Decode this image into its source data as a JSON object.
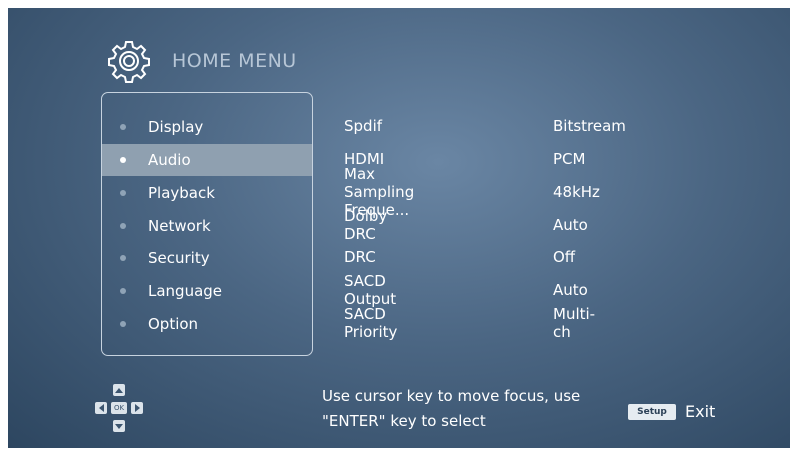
{
  "header": {
    "title": "HOME MENU",
    "icon": "gear-icon"
  },
  "menu": {
    "items": [
      {
        "label": "Display",
        "selected": false
      },
      {
        "label": "Audio",
        "selected": true
      },
      {
        "label": "Playback",
        "selected": false
      },
      {
        "label": "Network",
        "selected": false
      },
      {
        "label": "Security",
        "selected": false
      },
      {
        "label": "Language",
        "selected": false
      },
      {
        "label": "Option",
        "selected": false
      }
    ]
  },
  "settings": [
    {
      "label": "Spdif",
      "value": "Bitstream"
    },
    {
      "label": "HDMI",
      "value": "PCM"
    },
    {
      "label": "Max Sampling Freque...",
      "value": "48kHz"
    },
    {
      "label": "Dolby DRC",
      "value": "Auto"
    },
    {
      "label": "DRC",
      "value": "Off"
    },
    {
      "label": "SACD Output",
      "value": "Auto"
    },
    {
      "label": "SACD Priority",
      "value": "Multi-ch"
    }
  ],
  "footer": {
    "dpad_ok": "OK",
    "hint_line1": "Use cursor key to move focus, use",
    "hint_line2": "\"ENTER\" key to select",
    "setup_key": "Setup",
    "exit_label": "Exit"
  },
  "colors": {
    "background_center": "#6a86a4",
    "background_edge": "#2d4660",
    "selected_row": "#8fa0b0",
    "text": "#ffffff"
  }
}
